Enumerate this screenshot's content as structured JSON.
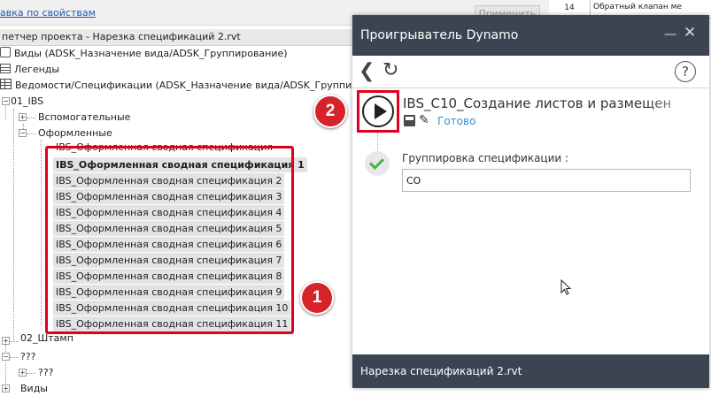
{
  "properties": {
    "link_label": "авка по свойствам",
    "apply_label": "Применить"
  },
  "project_browser": {
    "title": "петчер проекта - Нарезка спецификаций 2.rvt",
    "views": "Виды (ADSK_Назначение вида/ADSK_Группирование)",
    "legends": "Легенды",
    "schedules": "Ведомости/Спецификации (ADSK_Назначение вида/ADSK_Группиров",
    "group_01": "01_IBS",
    "auxiliary": "Вспомогательные",
    "formatted": "Оформленные",
    "schedule_top": "IBS_Оформленная сводная спецификация",
    "schedule_items": [
      "IBS_Оформленная сводная спецификация 1",
      "IBS_Оформленная сводная спецификация 2",
      "IBS_Оформленная сводная спецификация 3",
      "IBS_Оформленная сводная спецификация 4",
      "IBS_Оформленная сводная спецификация 5",
      "IBS_Оформленная сводная спецификация 6",
      "IBS_Оформленная сводная спецификация 7",
      "IBS_Оформленная сводная спецификация 8",
      "IBS_Оформленная сводная спецификация 9",
      "IBS_Оформленная сводная спецификация 10",
      "IBS_Оформленная сводная спецификация 11"
    ],
    "group_02": "02_Штамп",
    "unknown_1": "???",
    "unknown_2": "???",
    "views_bottom": "Виды"
  },
  "annotations": {
    "badge_1": "1",
    "badge_2": "2",
    "highlight_color": "#e0001a"
  },
  "top_table": {
    "row_number": "14",
    "row_text": "Обратный клапан ме"
  },
  "dynamo_player": {
    "title": "Проигрыватель Dynamo",
    "minimize_glyph": "—",
    "close_glyph": "✕",
    "script_name": "IBS_C10_Создание листов и размещен",
    "status": "Готово",
    "input_label": "Группировка спецификации :",
    "input_value": "СО",
    "footer_file": "Нарезка спецификаций 2.rvt",
    "header_color": "#3c4452",
    "status_color": "#3a8fd0"
  }
}
